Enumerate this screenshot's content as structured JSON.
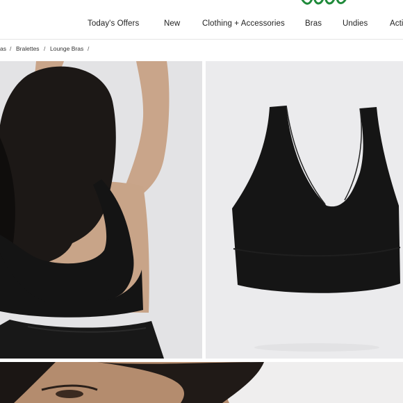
{
  "brand": {
    "logo_text": "aerie",
    "logo_color": "#1f8a3a"
  },
  "nav": {
    "items": [
      "Today's Offers",
      "New",
      "Clothing + Accessories",
      "Bras",
      "Undies",
      "Acti"
    ]
  },
  "breadcrumb": {
    "items": [
      "as",
      "Bralettes",
      "Lounge Bras"
    ],
    "separator": "/"
  },
  "gallery": {
    "images": [
      {
        "name": "model-back-view-photo",
        "icon": "product-photo"
      },
      {
        "name": "product-flat-photo",
        "icon": "product-photo"
      },
      {
        "name": "model-face-closeup-photo",
        "icon": "product-photo"
      }
    ],
    "product_color": "#141414"
  }
}
